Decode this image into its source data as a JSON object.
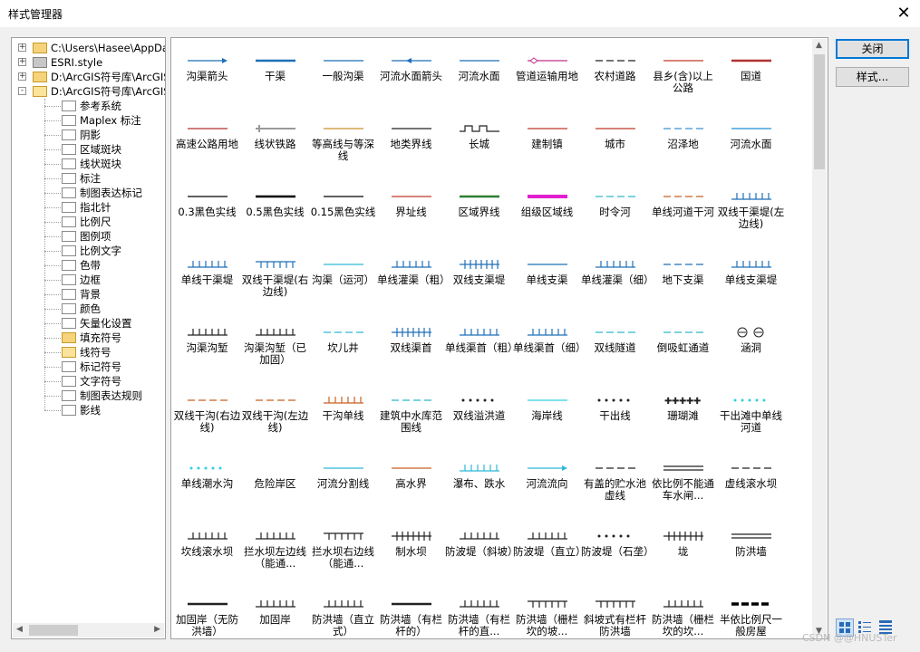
{
  "window": {
    "title": "样式管理器",
    "close_glyph": "✕"
  },
  "tree": {
    "items": [
      {
        "label": "C:\\Users\\Hasee\\AppData",
        "level": 0,
        "icon": "yellow",
        "expander": "+"
      },
      {
        "label": "ESRI.style",
        "level": 0,
        "icon": "gray",
        "expander": "+"
      },
      {
        "label": "D:\\ArcGIS符号库\\ArcGIS",
        "level": 0,
        "icon": "yellow",
        "expander": "+"
      },
      {
        "label": "D:\\ArcGIS符号库\\ArcGIS",
        "level": 0,
        "icon": "yellow-open",
        "expander": "-"
      },
      {
        "label": "参考系统",
        "level": 1,
        "icon": "white"
      },
      {
        "label": "Maplex 标注",
        "level": 1,
        "icon": "white"
      },
      {
        "label": "阴影",
        "level": 1,
        "icon": "white"
      },
      {
        "label": "区域斑块",
        "level": 1,
        "icon": "white"
      },
      {
        "label": "线状斑块",
        "level": 1,
        "icon": "white"
      },
      {
        "label": "标注",
        "level": 1,
        "icon": "white"
      },
      {
        "label": "制图表达标记",
        "level": 1,
        "icon": "white"
      },
      {
        "label": "指北针",
        "level": 1,
        "icon": "white"
      },
      {
        "label": "比例尺",
        "level": 1,
        "icon": "white"
      },
      {
        "label": "图例项",
        "level": 1,
        "icon": "white"
      },
      {
        "label": "比例文字",
        "level": 1,
        "icon": "white"
      },
      {
        "label": "色带",
        "level": 1,
        "icon": "white"
      },
      {
        "label": "边框",
        "level": 1,
        "icon": "white"
      },
      {
        "label": "背景",
        "level": 1,
        "icon": "white"
      },
      {
        "label": "颜色",
        "level": 1,
        "icon": "white"
      },
      {
        "label": "矢量化设置",
        "level": 1,
        "icon": "white"
      },
      {
        "label": "填充符号",
        "level": 1,
        "icon": "yellow"
      },
      {
        "label": "线符号",
        "level": 1,
        "icon": "yellow-open"
      },
      {
        "label": "标记符号",
        "level": 1,
        "icon": "white"
      },
      {
        "label": "文字符号",
        "level": 1,
        "icon": "white"
      },
      {
        "label": "制图表达规则",
        "level": 1,
        "icon": "white"
      },
      {
        "label": "影线",
        "level": 1,
        "icon": "white"
      }
    ]
  },
  "symbols": [
    {
      "label": "沟渠箭头",
      "style": "arrow",
      "color": "#1f6fb8"
    },
    {
      "label": "干渠",
      "style": "thick",
      "color": "#1f6fb8"
    },
    {
      "label": "一般沟渠",
      "style": "solid",
      "color": "#1f6fb8"
    },
    {
      "label": "河流水面箭头",
      "style": "arrowleft",
      "color": "#1f6fb8"
    },
    {
      "label": "河流水面",
      "style": "solid",
      "color": "#1f6fb8"
    },
    {
      "label": "管道运输用地",
      "style": "diamond",
      "color": "#c0308a"
    },
    {
      "label": "农村道路",
      "style": "dash",
      "color": "#222222"
    },
    {
      "label": "县乡(含)以上公路",
      "style": "solid",
      "color": "#c0392b"
    },
    {
      "label": "国道",
      "style": "thick",
      "color": "#b03030"
    },
    {
      "label": "高速公路用地",
      "style": "solid",
      "color": "#b03030"
    },
    {
      "label": "线状铁路",
      "style": "rail",
      "color": "#999999"
    },
    {
      "label": "等高线与等深线",
      "style": "solid",
      "color": "#c8902a"
    },
    {
      "label": "地类界线",
      "style": "solid",
      "color": "#222222"
    },
    {
      "label": "长城",
      "style": "wall",
      "color": "#222222"
    },
    {
      "label": "建制镇",
      "style": "solid",
      "color": "#c0392b"
    },
    {
      "label": "城市",
      "style": "solid",
      "color": "#c0392b"
    },
    {
      "label": "沼泽地",
      "style": "dash",
      "color": "#3c8fd0"
    },
    {
      "label": "河流水面",
      "style": "solid",
      "color": "#1f8fd8"
    },
    {
      "label": "0.3黑色实线",
      "style": "solid",
      "color": "#000000"
    },
    {
      "label": "0.5黑色实线",
      "style": "thick",
      "color": "#000000"
    },
    {
      "label": "0.15黑色实线",
      "style": "solid",
      "color": "#000000"
    },
    {
      "label": "界址线",
      "style": "solid",
      "color": "#c0392b"
    },
    {
      "label": "区域界线",
      "style": "thick",
      "color": "#2e7d32"
    },
    {
      "label": "组级区域线",
      "style": "xthick",
      "color": "#e020d0"
    },
    {
      "label": "时令河",
      "style": "dash",
      "color": "#2fb8c8"
    },
    {
      "label": "单线河道干河",
      "style": "dash",
      "color": "#c86020"
    },
    {
      "label": "双线干渠堤(左边线)",
      "style": "ticksup",
      "color": "#1f6fb8"
    },
    {
      "label": "单线干渠堤",
      "style": "ticksup",
      "color": "#1f6fb8"
    },
    {
      "label": "双线干渠堤(右边线)",
      "style": "ticksdown",
      "color": "#1f6fb8"
    },
    {
      "label": "沟渠（运河）",
      "style": "solid",
      "color": "#2fb8d8"
    },
    {
      "label": "单线灌渠（粗）",
      "style": "ticksup",
      "color": "#1f6fb8"
    },
    {
      "label": "双线支渠堤",
      "style": "ticksboth",
      "color": "#1f6fb8"
    },
    {
      "label": "单线支渠",
      "style": "solid",
      "color": "#1f6fb8"
    },
    {
      "label": "单线灌渠（细）",
      "style": "ticksup",
      "color": "#1f6fb8"
    },
    {
      "label": "地下支渠",
      "style": "dash",
      "color": "#1f6fb8"
    },
    {
      "label": "单线支渠堤",
      "style": "ticksup",
      "color": "#1f6fb8"
    },
    {
      "label": "沟渠沟堑",
      "style": "ticksup",
      "color": "#222222"
    },
    {
      "label": "沟渠沟堑（已加固）",
      "style": "ticksup",
      "color": "#222222"
    },
    {
      "label": "坎儿井",
      "style": "dash",
      "color": "#2fb8d8"
    },
    {
      "label": "双线渠首",
      "style": "ticksboth",
      "color": "#1f6fb8"
    },
    {
      "label": "单线渠首（粗）",
      "style": "ticksup",
      "color": "#1f6fb8"
    },
    {
      "label": "单线渠首（细）",
      "style": "ticksup",
      "color": "#1f6fb8"
    },
    {
      "label": "双线隧道",
      "style": "dash",
      "color": "#2fb8c8"
    },
    {
      "label": "倒吸虹通道",
      "style": "dash",
      "color": "#2fb8c8"
    },
    {
      "label": "涵洞",
      "style": "circles",
      "color": "#222222"
    },
    {
      "label": "双线干沟(右边线)",
      "style": "dash",
      "color": "#c86020"
    },
    {
      "label": "双线干沟(左边线)",
      "style": "dash",
      "color": "#c86020"
    },
    {
      "label": "干沟单线",
      "style": "ticksup",
      "color": "#c86020"
    },
    {
      "label": "建筑中水库范围线",
      "style": "dash",
      "color": "#2fb8c8"
    },
    {
      "label": "双线溢洪道",
      "style": "dots",
      "color": "#222222"
    },
    {
      "label": "海岸线",
      "style": "solid",
      "color": "#2fd0e0"
    },
    {
      "label": "干出线",
      "style": "dots",
      "color": "#222222"
    },
    {
      "label": "珊瑚滩",
      "style": "plus",
      "color": "#222222"
    },
    {
      "label": "干出滩中单线河道",
      "style": "dots",
      "color": "#2fd0e0"
    },
    {
      "label": "单线潮水沟",
      "style": "dots",
      "color": "#2fd0e0"
    },
    {
      "label": "危险岸区",
      "style": "none",
      "color": "#222222"
    },
    {
      "label": "河流分割线",
      "style": "solid",
      "color": "#2fb8d8"
    },
    {
      "label": "高水界",
      "style": "solid",
      "color": "#c86020"
    },
    {
      "label": "瀑布、跌水",
      "style": "ticksup",
      "color": "#2fb8d8"
    },
    {
      "label": "河流流向",
      "style": "arrow",
      "color": "#2fb8d8"
    },
    {
      "label": "有盖的贮水池虚线",
      "style": "dash",
      "color": "#222222"
    },
    {
      "label": "依比例不能通车水闸...",
      "style": "double",
      "color": "#222222"
    },
    {
      "label": "虚线滚水坝",
      "style": "dash",
      "color": "#222222"
    },
    {
      "label": "坎线滚水坝",
      "style": "ticksup",
      "color": "#222222"
    },
    {
      "label": "拦水坝左边线（能通...",
      "style": "ticksup",
      "color": "#222222"
    },
    {
      "label": "拦水坝右边线（能通...",
      "style": "ticksdown",
      "color": "#222222"
    },
    {
      "label": "制水坝",
      "style": "ticksboth",
      "color": "#222222"
    },
    {
      "label": "防波堤（斜坡）",
      "style": "ticksup",
      "color": "#222222"
    },
    {
      "label": "防波堤（直立）",
      "style": "ticksup",
      "color": "#222222"
    },
    {
      "label": "防波堤（石垄）",
      "style": "dots",
      "color": "#222222"
    },
    {
      "label": "垅",
      "style": "ticksboth",
      "color": "#222222"
    },
    {
      "label": "防洪墙",
      "style": "double",
      "color": "#222222"
    },
    {
      "label": "加固岸（无防洪墙）",
      "style": "thick",
      "color": "#222222"
    },
    {
      "label": "加固岸",
      "style": "ticksup",
      "color": "#222222"
    },
    {
      "label": "防洪墙（直立式）",
      "style": "ticksup",
      "color": "#222222"
    },
    {
      "label": "防洪墙（有栏杆的）",
      "style": "thick",
      "color": "#222222"
    },
    {
      "label": "防洪墙（有栏杆的直...",
      "style": "ticksup",
      "color": "#222222"
    },
    {
      "label": "防洪墙（栅栏坎的坡...",
      "style": "ticksdown",
      "color": "#222222"
    },
    {
      "label": "斜坡式有栏杆防洪墙",
      "style": "ticksdown",
      "color": "#222222"
    },
    {
      "label": "防洪墙（栅栏坎的坎...",
      "style": "ticksup",
      "color": "#222222"
    },
    {
      "label": "半依比例尺一般房屋",
      "style": "xthickdash",
      "color": "#000000"
    }
  ],
  "buttons": {
    "close": "关闭",
    "style": "样式..."
  },
  "watermark": "CSDN @@HNUSTer"
}
